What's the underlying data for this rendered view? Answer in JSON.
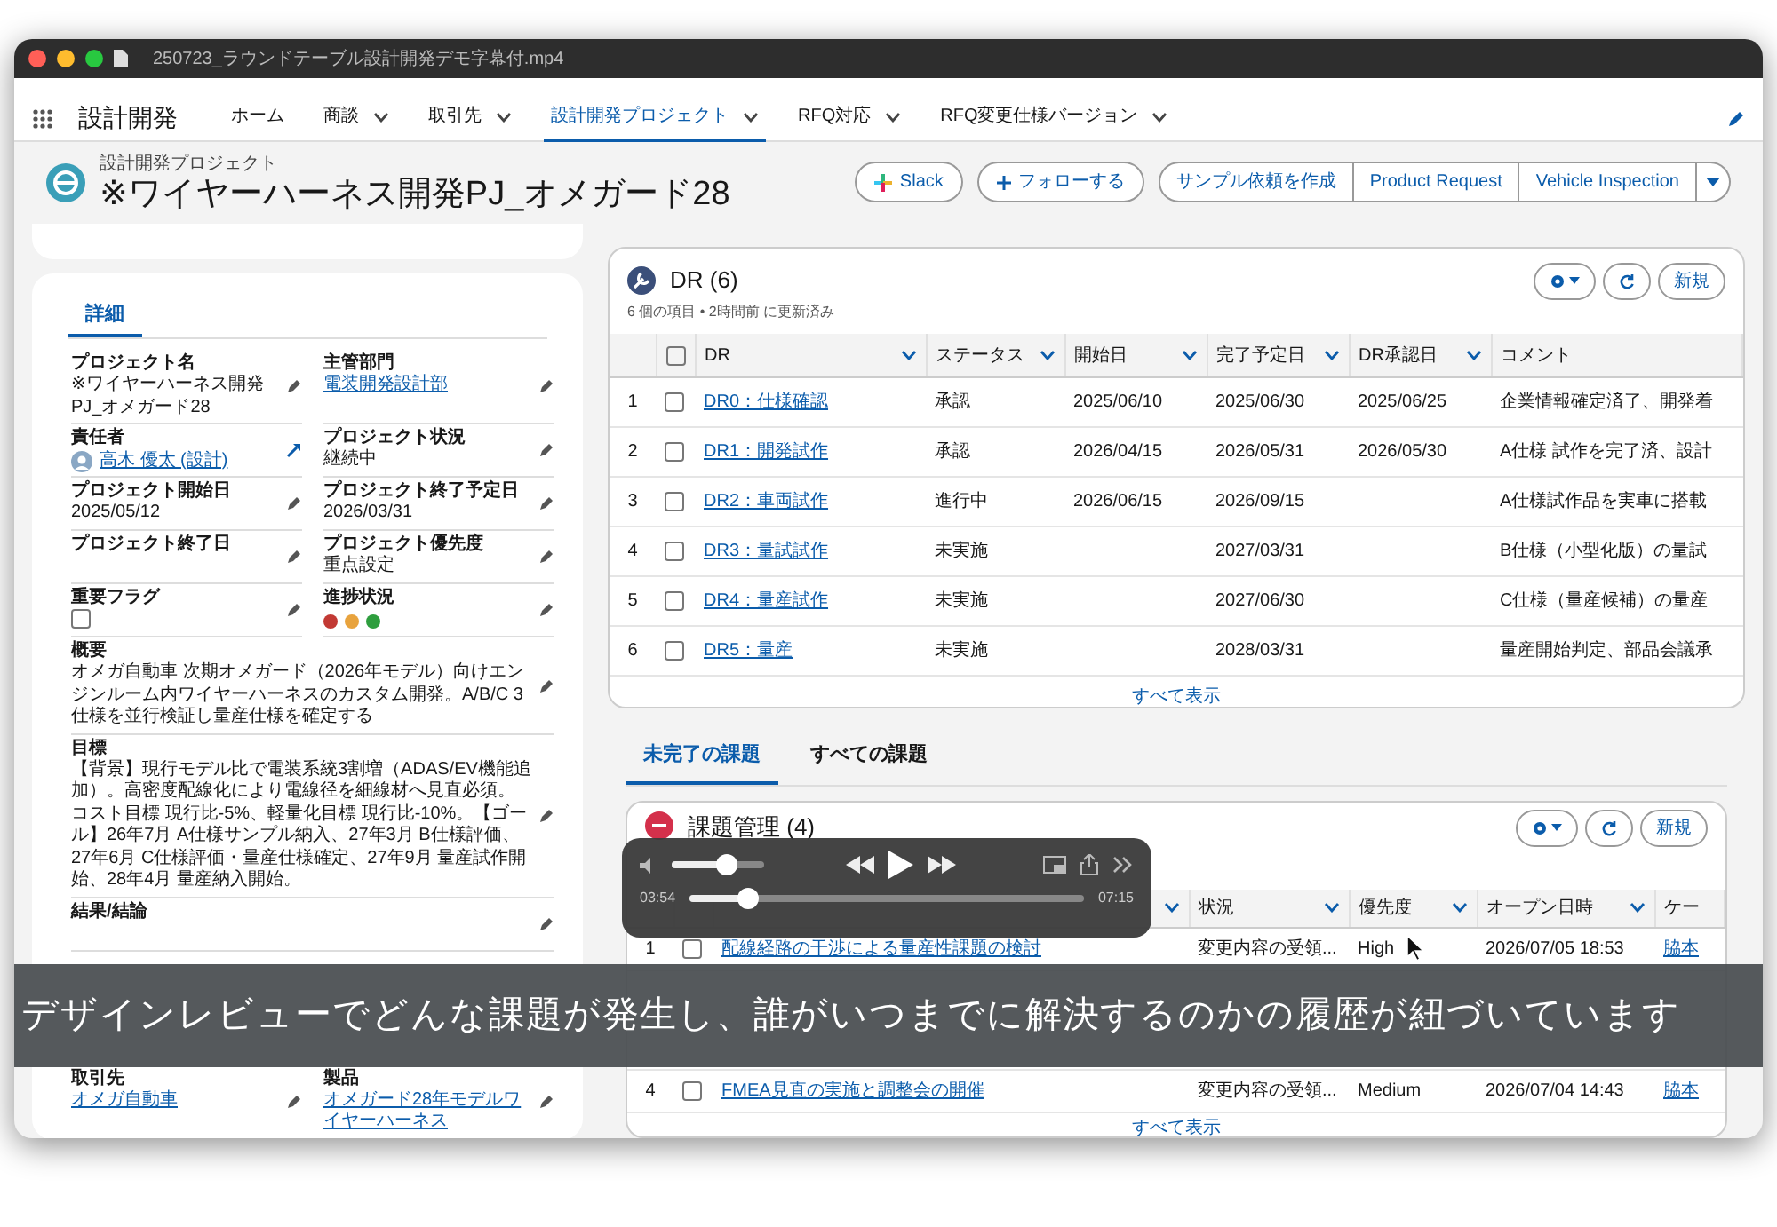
{
  "window": {
    "title": "250723_ラウンドテーブル設計開発デモ字幕付.mp4"
  },
  "app": {
    "name": "設計開発"
  },
  "nav_tabs": [
    {
      "label": "ホーム",
      "dropdown": false,
      "selected": false
    },
    {
      "label": "商談",
      "dropdown": true,
      "selected": false
    },
    {
      "label": "取引先",
      "dropdown": true,
      "selected": false
    },
    {
      "label": "設計開発プロジェクト",
      "dropdown": true,
      "selected": true
    },
    {
      "label": "RFQ対応",
      "dropdown": true,
      "selected": false
    },
    {
      "label": "RFQ変更仕様バージョン",
      "dropdown": true,
      "selected": false
    }
  ],
  "record": {
    "object": "設計開発プロジェクト",
    "title": "※ワイヤーハーネス開発PJ_オメガード28"
  },
  "actions": [
    {
      "kind": "slack",
      "label": "Slack"
    },
    {
      "kind": "follow",
      "label": "フォローする"
    },
    {
      "kind": "plain",
      "label": "サンプル依頼を作成"
    },
    {
      "kind": "plain",
      "label": "Product Request"
    },
    {
      "kind": "plain",
      "label": "Vehicle Inspection"
    },
    {
      "kind": "menu"
    }
  ],
  "details": {
    "tab": {
      "label": "詳細",
      "selected": true
    },
    "fields": [
      {
        "kind": "text",
        "label": "プロジェクト名",
        "value": "※ワイヤーハーネス開発PJ_オメガード28"
      },
      {
        "kind": "link",
        "label": "主管部門",
        "value": "電装開発設計部"
      },
      {
        "kind": "user",
        "label": "責任者",
        "value": "高木 優太 (設計)"
      },
      {
        "kind": "text",
        "label": "プロジェクト状況",
        "value": "継続中"
      },
      {
        "kind": "text",
        "label": "プロジェクト開始日",
        "value": "2025/05/12"
      },
      {
        "kind": "text",
        "label": "プロジェクト終了予定日",
        "value": "2026/03/31"
      },
      {
        "kind": "text",
        "label": "プロジェクト終了日"
      },
      {
        "kind": "text",
        "label": "プロジェクト優先度",
        "value": "重点設定"
      },
      {
        "kind": "checkbox",
        "label": "重要フラグ",
        "checked": false
      },
      {
        "kind": "signal",
        "label": "進捗状況",
        "dots": [
          {
            "color": "#c23934"
          },
          {
            "color": "#e8a33d"
          },
          {
            "color": "#2e9e3e"
          }
        ]
      },
      {
        "kind": "text",
        "wide": true,
        "label": "概要",
        "value": "オメガ自動車 次期オメガード（2026年モデル）向けエンジンルーム内ワイヤーハーネスのカスタム開発。A/B/C 3仕様を並行検証し量産仕様を確定する"
      },
      {
        "kind": "text",
        "wide": true,
        "label": "目標",
        "value": "【背景】現行モデル比で電装系統3割増（ADAS/EV機能追加）。高密度配線化により電線径を細線材へ見直必須。コスト目標 現行比-5%、軽量化目標 現行比-10%。【ゴール】26年7月 A仕様サンプル納入、27年3月 B仕様評価、27年6月 C仕様評価・量産仕様確定、27年9月 量産試作開始、28年4月 量産納入開始。"
      },
      {
        "kind": "text",
        "wide": true,
        "label": "結果/結論"
      },
      {
        "kind": "link",
        "label": "取引先",
        "value": "オメガ自動車",
        "after_gap": true
      },
      {
        "kind": "link",
        "label": "製品",
        "value": "オメガード28年モデルワイヤーハーネス"
      }
    ]
  },
  "dr": {
    "title": "DR (6)",
    "meta": "6 個の項目 • 2時間前 に更新済み",
    "new_button": "新規",
    "select_all_checked": false,
    "columns": [
      "DR",
      "ステータス",
      "開始日",
      "完了予定日",
      "DR承認日",
      "コメント"
    ],
    "rows": [
      {
        "num": "1",
        "checked": false,
        "cells": [
          "DR0：仕様確認",
          "承認",
          "2025/06/10",
          "2025/06/30",
          "2025/06/25",
          "企業情報確定済了、開発着"
        ]
      },
      {
        "num": "2",
        "checked": false,
        "cells": [
          "DR1：開発試作",
          "承認",
          "2026/04/15",
          "2026/05/31",
          "2026/05/30",
          "A仕様 試作を完了済、設計"
        ]
      },
      {
        "num": "3",
        "checked": false,
        "cells": [
          "DR2：車両試作",
          "進行中",
          "2026/06/15",
          "2026/09/15",
          "",
          "A仕様試作品を実車に搭載"
        ]
      },
      {
        "num": "4",
        "checked": false,
        "cells": [
          "DR3：量試試作",
          "未実施",
          "",
          "2027/03/31",
          "",
          "B仕様（小型化版）の量試"
        ]
      },
      {
        "num": "5",
        "checked": false,
        "cells": [
          "DR4：量産試作",
          "未実施",
          "",
          "2027/06/30",
          "",
          "C仕様（量産候補）の量産"
        ]
      },
      {
        "num": "6",
        "checked": false,
        "cells": [
          "DR5：量産",
          "未実施",
          "",
          "2028/03/31",
          "",
          "量産開始判定、部品会議承"
        ]
      }
    ],
    "footer": "すべて表示"
  },
  "issue_tabs": [
    {
      "label": "未完了の課題",
      "selected": true
    },
    {
      "label": "すべての課題",
      "selected": false
    }
  ],
  "issues": {
    "title": "課題管理 (4)",
    "new_button": "新規",
    "columns": [
      "",
      "状況",
      "優先度",
      "オープン日時",
      "ケー"
    ],
    "rows": [
      {
        "num": "1",
        "checked": false,
        "cells": [
          "配線経路の干渉による量産性課題の検討",
          "変更内容の受領...",
          "High",
          "2026/07/05 18:53",
          "脇本"
        ]
      },
      {
        "num": "4",
        "checked": false,
        "after_gap": true,
        "cells": [
          "FMEA見直の実施と調整会の開催",
          "変更内容の受領...",
          "Medium",
          "2026/07/04 14:43",
          "脇本"
        ]
      }
    ],
    "footer": "すべて表示"
  },
  "player": {
    "volume": {
      "level": 0.6
    },
    "progress": {
      "level": 0.15
    },
    "elapsed": "03:54",
    "duration": "07:15"
  },
  "subtitle": "デザインレビューでどんな課題が発生し、誰がいつまでに解決するのかの履歴が紐づいています"
}
